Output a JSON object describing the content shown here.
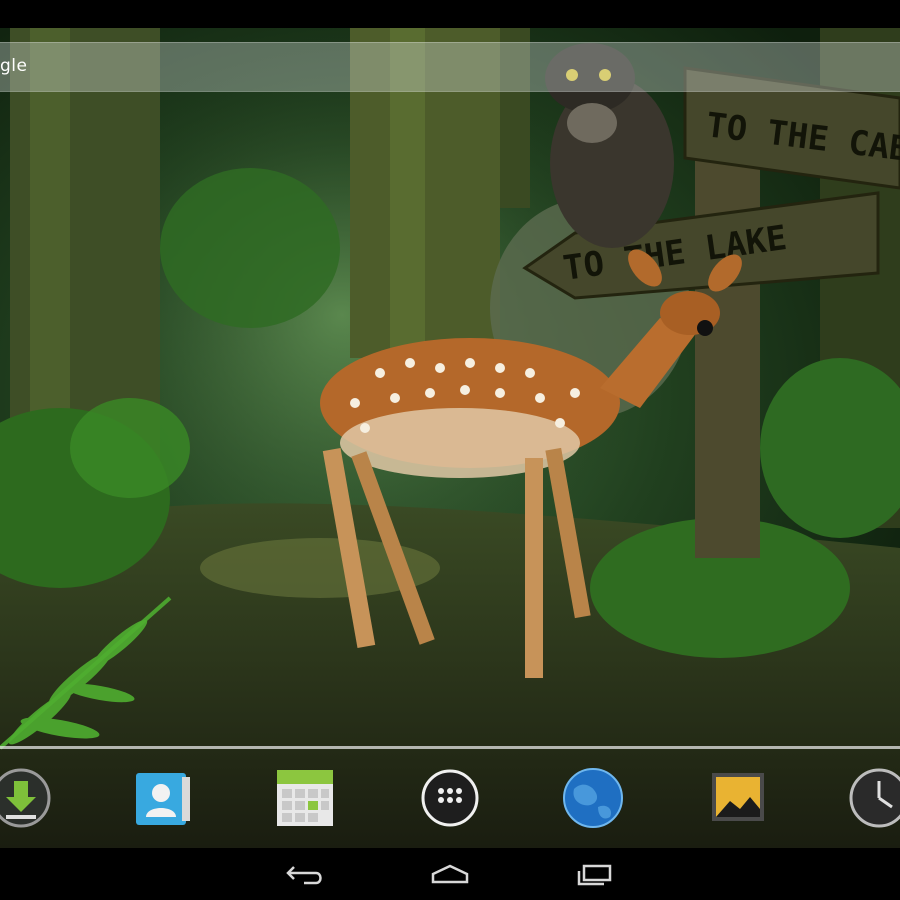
{
  "search_bar": {
    "label": "gle"
  },
  "wallpaper": {
    "sign_upper": "TO THE CAB",
    "sign_lower": "TO THE LAKE"
  },
  "dock": {
    "items": [
      {
        "name": "downloads",
        "icon": "download-icon"
      },
      {
        "name": "contacts",
        "icon": "contacts-icon"
      },
      {
        "name": "calendar",
        "icon": "calendar-icon"
      },
      {
        "name": "all-apps",
        "icon": "apps-grid-icon"
      },
      {
        "name": "browser",
        "icon": "globe-icon"
      },
      {
        "name": "gallery",
        "icon": "gallery-icon"
      },
      {
        "name": "clock",
        "icon": "clock-icon"
      }
    ]
  },
  "navbar": {
    "buttons": [
      {
        "name": "back",
        "icon": "back-icon"
      },
      {
        "name": "home",
        "icon": "home-icon"
      },
      {
        "name": "recents",
        "icon": "recents-icon"
      }
    ]
  }
}
